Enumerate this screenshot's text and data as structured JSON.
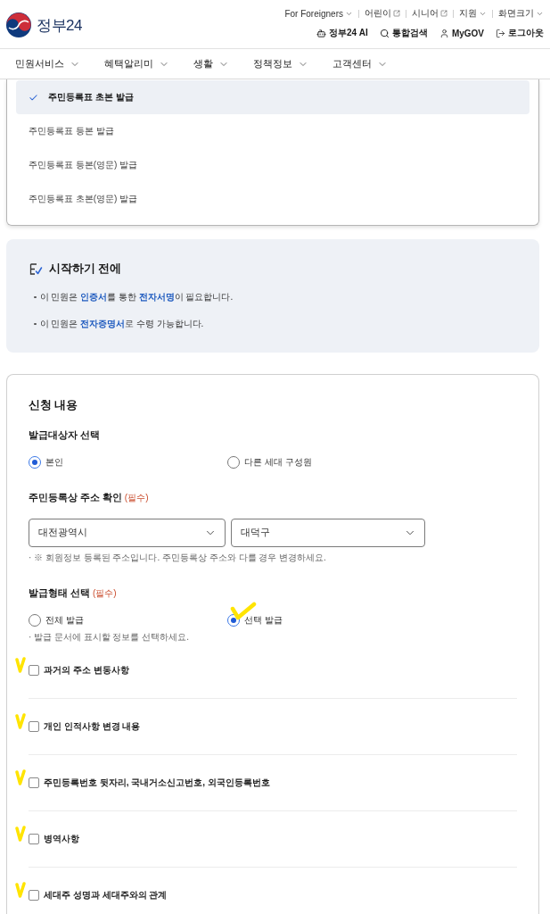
{
  "header": {
    "logo": "정부24",
    "utility_links": [
      {
        "label": "For Foreigners",
        "kind": "dropdown"
      },
      {
        "label": "어린이",
        "kind": "external"
      },
      {
        "label": "시니어",
        "kind": "external"
      },
      {
        "label": "지원",
        "kind": "dropdown"
      },
      {
        "label": "화면크기",
        "kind": "dropdown"
      }
    ],
    "actions": [
      {
        "label": "정부24 AI",
        "kind": "ai"
      },
      {
        "label": "통합검색",
        "kind": "search"
      },
      {
        "label": "MyGOV",
        "kind": "user"
      },
      {
        "label": "로그아웃",
        "kind": "logout"
      }
    ]
  },
  "nav": [
    {
      "label": "민원서비스"
    },
    {
      "label": "혜택알리미"
    },
    {
      "label": "생활"
    },
    {
      "label": "정책정보"
    },
    {
      "label": "고객센터"
    }
  ],
  "certificate_menu": [
    {
      "label": "주민등록표 초본 발급",
      "selected": true
    },
    {
      "label": "주민등록표 등본 발급",
      "selected": false
    },
    {
      "label": "주민등록표 등본(영문) 발급",
      "selected": false
    },
    {
      "label": "주민등록표 초본(영문) 발급",
      "selected": false
    }
  ],
  "notice": {
    "title": "시작하기 전에",
    "items": [
      "이 민원은 **인증서**를 통한 **전자서명**이 필요합니다.",
      "이 민원은 **전자증명서**로 수령 가능합니다."
    ]
  },
  "application": {
    "title": "신청 내용",
    "target": {
      "label": "발급대상자 선택",
      "options": [
        {
          "label": "본인",
          "selected": true
        },
        {
          "label": "다른 세대 구성원",
          "selected": false
        }
      ]
    },
    "address": {
      "label": "주민등록상 주소 확인",
      "required_mark": "(필수)",
      "selects": [
        {
          "value": "대전광역시"
        },
        {
          "value": "대덕구"
        }
      ],
      "note": "· ※ 회원정보 등록된 주소입니다. 주민등록상 주소와 다를 경우 변경하세요."
    },
    "issue_type": {
      "label": "발급형태 선택",
      "required_mark": "(필수)",
      "options": [
        {
          "label": "전체 발급",
          "selected": false,
          "annotated": false
        },
        {
          "label": "선택 발급",
          "selected": true,
          "annotated": true
        }
      ],
      "note": "· 발급 문서에 표시할 정보를 선택하세요."
    },
    "display_items": [
      {
        "label": "과거의 주소 변동사항",
        "checked": false,
        "annotated": true
      },
      {
        "label": "개인 인적사항 변경 내용",
        "checked": false,
        "annotated": true
      },
      {
        "label": "주민등록번호 뒷자리, 국내거소신고번호, 외국인등록번호",
        "checked": false,
        "annotated": true
      },
      {
        "label": "병역사항",
        "checked": false,
        "annotated": true
      },
      {
        "label": "세대주 성명과 세대주와의 관계",
        "checked": false,
        "annotated": true
      }
    ]
  }
}
